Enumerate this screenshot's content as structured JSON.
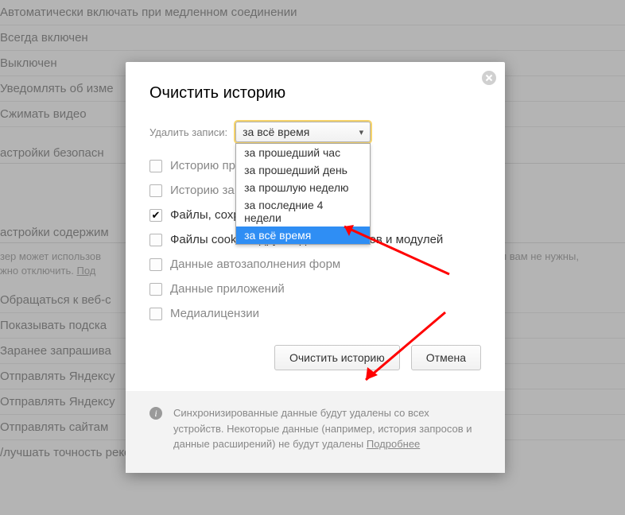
{
  "bg": {
    "lines": [
      "Автоматически включать при медленном соединении",
      "Всегда включен",
      "Выключен",
      "Уведомлять об изме",
      "Сжимать видео"
    ],
    "section1": "астройки безопасн",
    "section2": "астройки содержим",
    "desc_a": "зер может использов",
    "desc_b": "жности вам не нужны,",
    "desc_c": "жно отключить. ",
    "desc_link": "Под",
    "lines2": [
      "Обращаться к веб-с",
      "Показывать подска",
      "Заранее запрашива",
      "Отправлять Яндексу",
      "Отправлять Яндексу",
      "Отправлять сайтам"
    ],
    "last": "/лучшать точность рекомендаций Дзена и качество рекламы с помощью данных из"
  },
  "dialog": {
    "title": "Очистить историю",
    "delete_label": "Удалить записи:",
    "combo_value": "за всё время",
    "options": [
      "за прошедший час",
      "за прошедший день",
      "за прошлую неделю",
      "за последние 4 недели",
      "за всё время"
    ],
    "items": [
      {
        "label": "Историю пр",
        "checked": false,
        "dim": true
      },
      {
        "label": "Историю за",
        "checked": false,
        "dim": true
      },
      {
        "label": "Файлы, сохраненные в кэше (…)",
        "checked": true,
        "dim": false
      },
      {
        "label": "Файлы cookie и другие данные сайтов и модулей",
        "checked": false,
        "dim": false
      },
      {
        "label": "Данные автозаполнения форм",
        "checked": false,
        "dim": true
      },
      {
        "label": "Данные приложений",
        "checked": false,
        "dim": true
      },
      {
        "label": "Медиалицензии",
        "checked": false,
        "dim": true
      }
    ],
    "clear_btn": "Очистить историю",
    "cancel_btn": "Отмена",
    "footer_text": "Синхронизированные данные будут удалены со всех устройств. Некоторые данные (например, история запросов и данные расширений) не будут удалены ",
    "footer_link": "Подробнее"
  }
}
